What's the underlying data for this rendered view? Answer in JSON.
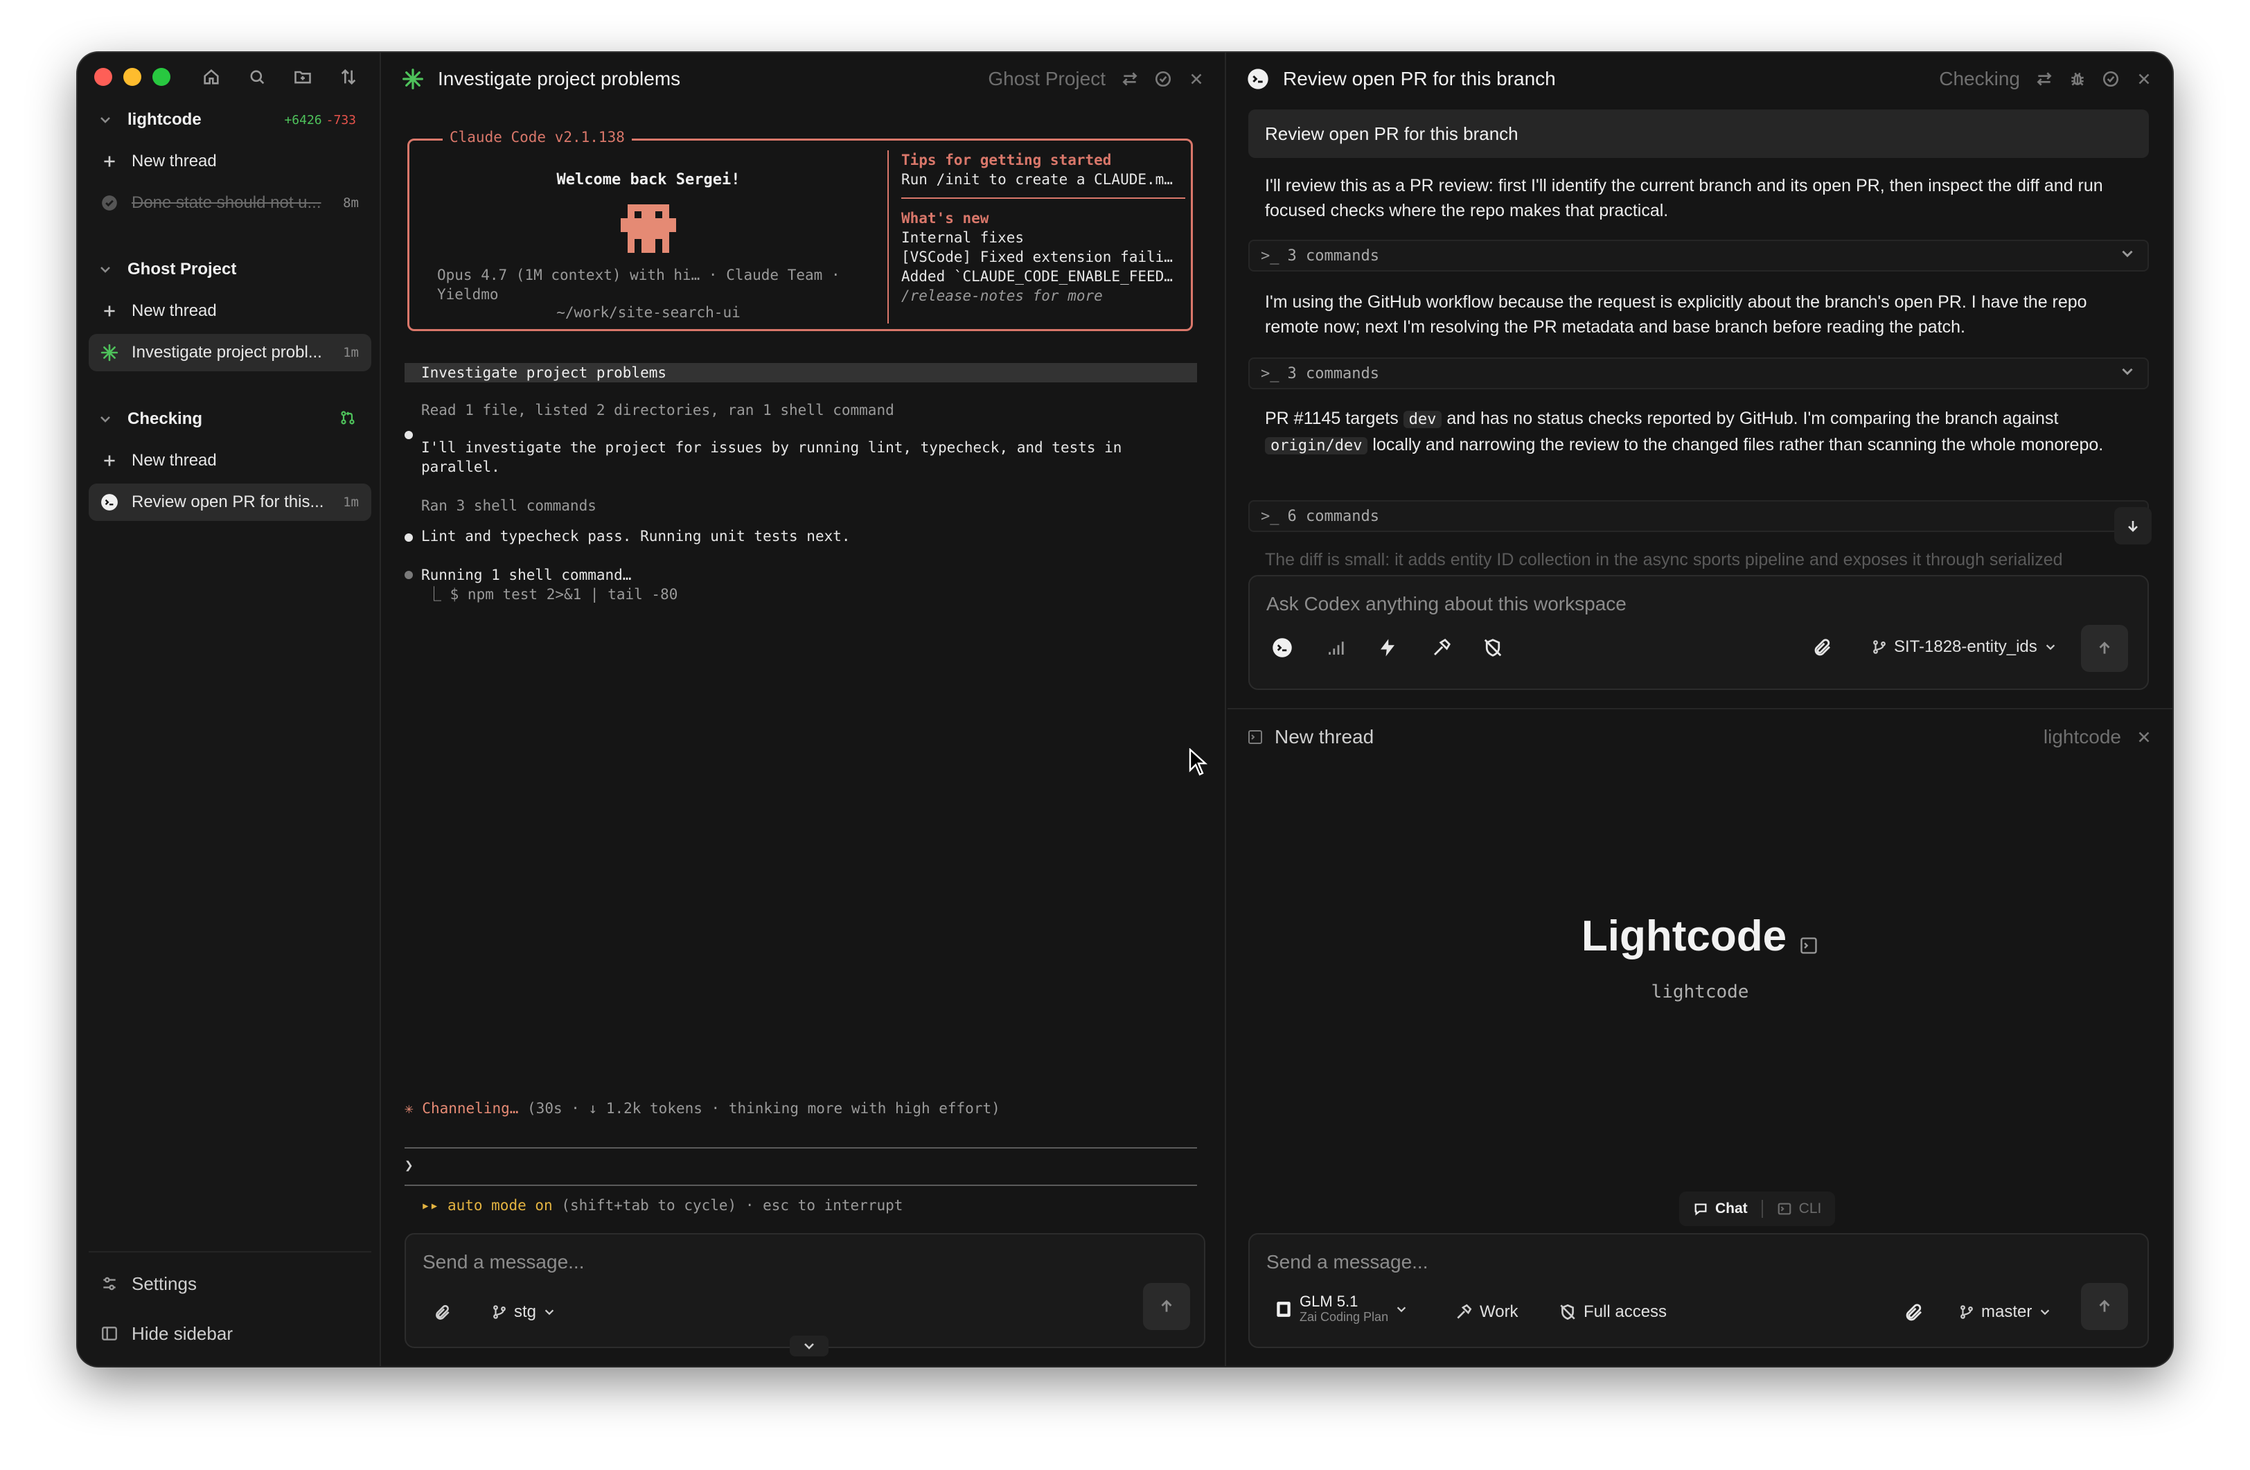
{
  "sidebar": {
    "groups": [
      {
        "title": "lightcode",
        "diff_add": "+6426",
        "diff_del": "-733",
        "new_thread_label": "New thread",
        "threads": [
          {
            "label": "Done state should not u...",
            "age": "8m",
            "state": "done"
          }
        ]
      },
      {
        "title": "Ghost Project",
        "new_thread_label": "New thread",
        "threads": [
          {
            "label": "Investigate project probl...",
            "age": "1m",
            "state": "active"
          }
        ]
      },
      {
        "title": "Checking",
        "new_thread_label": "New thread",
        "threads": [
          {
            "label": "Review open PR for this...",
            "age": "1m",
            "state": "active"
          }
        ]
      }
    ],
    "settings_label": "Settings",
    "hide_sidebar_label": "Hide sidebar"
  },
  "middle": {
    "title": "Investigate project problems",
    "project": "Ghost Project",
    "welcome": {
      "version": "Claude Code v2.1.138",
      "greeting": "Welcome back Sergei!",
      "model_line1": "Opus 4.7 (1M context) with hi… · Claude Team ·",
      "model_line2": "Yieldmo",
      "cwd": "~/work/site-search-ui",
      "tips_heading": "Tips for getting started",
      "tips_text": "Run /init to create a CLAUDE.m…",
      "whats_new_heading": "What's new",
      "new_1": "Internal fixes",
      "new_2": "[VSCode] Fixed extension faili…",
      "new_3": "Added `CLAUDE_CODE_ENABLE_FEED…",
      "release_notes": "/release-notes for more"
    },
    "prompt_echo": "Investigate project problems",
    "log": {
      "read_summary": "Read 1 file, listed 2 directories, ran 1 shell command",
      "msg1_line1": "I'll investigate the project for issues by running lint, typecheck, and tests in",
      "msg1_line2": "parallel.",
      "ran_summary": "Ran 3 shell commands",
      "msg2": "Lint and typecheck pass. Running unit tests next.",
      "running": "Running 1 shell command…",
      "running_cmd": "⎿  $ npm test 2>&1 | tail -80"
    },
    "status_verb": "Channeling…",
    "status_detail": "(30s · ↓ 1.2k tokens · thinking more with high effort)",
    "prompt_char": "❯",
    "auto_mode": "auto mode on",
    "auto_hint": "(shift+tab to cycle) · esc to interrupt",
    "composer_placeholder": "Send a message...",
    "branch": "stg"
  },
  "right": {
    "title": "Review open PR for this branch",
    "project": "Checking",
    "user_message": "Review open PR for this branch",
    "para1": "I'll review this as a PR review: first I'll identify the current branch and its open PR, then inspect the diff and run focused checks where the repo makes that practical.",
    "cmds1": "3 commands",
    "para2": "I'm using the GitHub workflow because the request is explicitly about the branch's open PR. I have the repo remote now; next I'm resolving the PR metadata and base branch before reading the patch.",
    "cmds2": "3 commands",
    "para3_a": "PR #1145 targets",
    "para3_code1": "dev",
    "para3_b": "and has no status checks reported by GitHub. I'm comparing the branch against",
    "para3_code2": "origin/dev",
    "para3_c": "locally and narrowing the review to the changed files rather than scanning the whole monorepo.",
    "cmds3": "6 commands",
    "faded": "The diff is small: it adds entity ID collection in the async sports pipeline and exposes it through serialized",
    "composer_placeholder": "Ask Codex anything about this workspace",
    "branch": "SIT-1828-entity_ids",
    "new_thread": {
      "title": "New thread",
      "project": "lightcode",
      "brand": "Lightcode",
      "subtitle": "lightcode",
      "mode_chat": "Chat",
      "mode_cli": "CLI",
      "composer_placeholder": "Send a message...",
      "model_name": "GLM 5.1",
      "model_plan": "Zai Coding Plan",
      "work_label": "Work",
      "access_label": "Full access",
      "branch": "master"
    }
  },
  "colors": {
    "accent_claude": "#d9776a",
    "diff_add": "#4ec25b",
    "diff_del": "#e5534b",
    "auto_mode": "#e3b341",
    "checking_icon": "#4ec25b"
  }
}
